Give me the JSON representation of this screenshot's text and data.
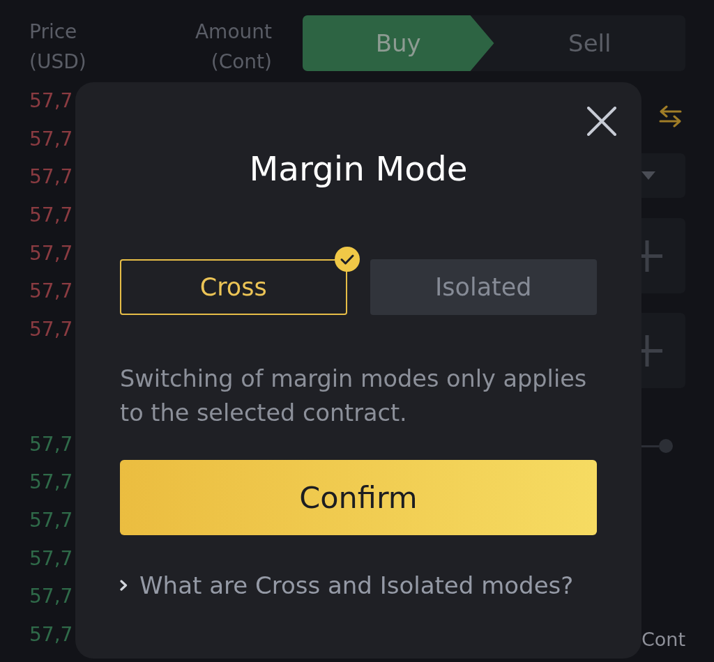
{
  "order_book": {
    "headers": [
      "Price (USD)",
      "Amount (Cont)"
    ],
    "asks": [
      "57,7",
      "57,7",
      "57,7",
      "57,7",
      "57,7",
      "57,7",
      "57,7"
    ],
    "bids": [
      "57,7",
      "57,7",
      "57,7",
      "57,7",
      "57,7",
      "57,7"
    ]
  },
  "trade_tabs": [
    {
      "label": "Buy",
      "selected": true
    },
    {
      "label": "Sell",
      "selected": false
    }
  ],
  "order_form": {
    "unit": "Cont"
  },
  "dialog": {
    "title": "Margin Mode",
    "options": [
      {
        "label": "Cross",
        "selected": true
      },
      {
        "label": "Isolated",
        "selected": false
      }
    ],
    "description": "Switching of margin modes only applies to the selected contract.",
    "confirm": "Confirm",
    "help_link": "What are Cross and Isolated modes?"
  }
}
